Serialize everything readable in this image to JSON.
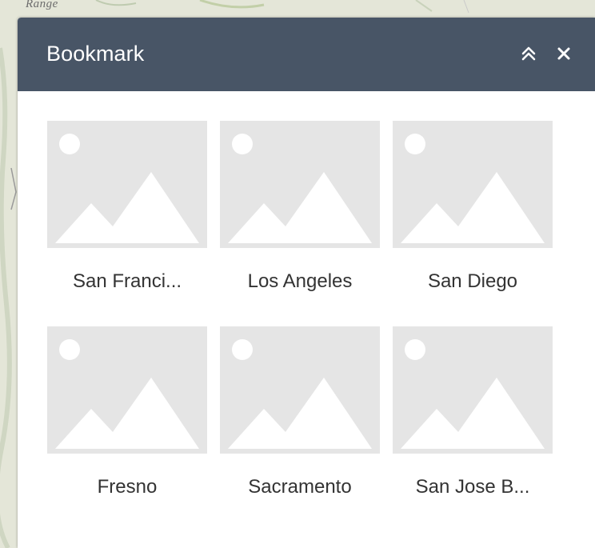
{
  "map": {
    "label": "Range"
  },
  "panel": {
    "title": "Bookmark",
    "header_color": "#485566",
    "collapse_icon": "double-chevron-up-icon",
    "close_icon": "close-icon"
  },
  "bookmarks": [
    {
      "label": "San Franci..."
    },
    {
      "label": "Los Angeles"
    },
    {
      "label": "San Diego"
    },
    {
      "label": "Fresno"
    },
    {
      "label": "Sacramento"
    },
    {
      "label": "San Jose B..."
    }
  ],
  "colors": {
    "thumbnail_bg": "#e5e5e5",
    "thumbnail_glyph": "#ffffff",
    "label_text": "#333333"
  }
}
